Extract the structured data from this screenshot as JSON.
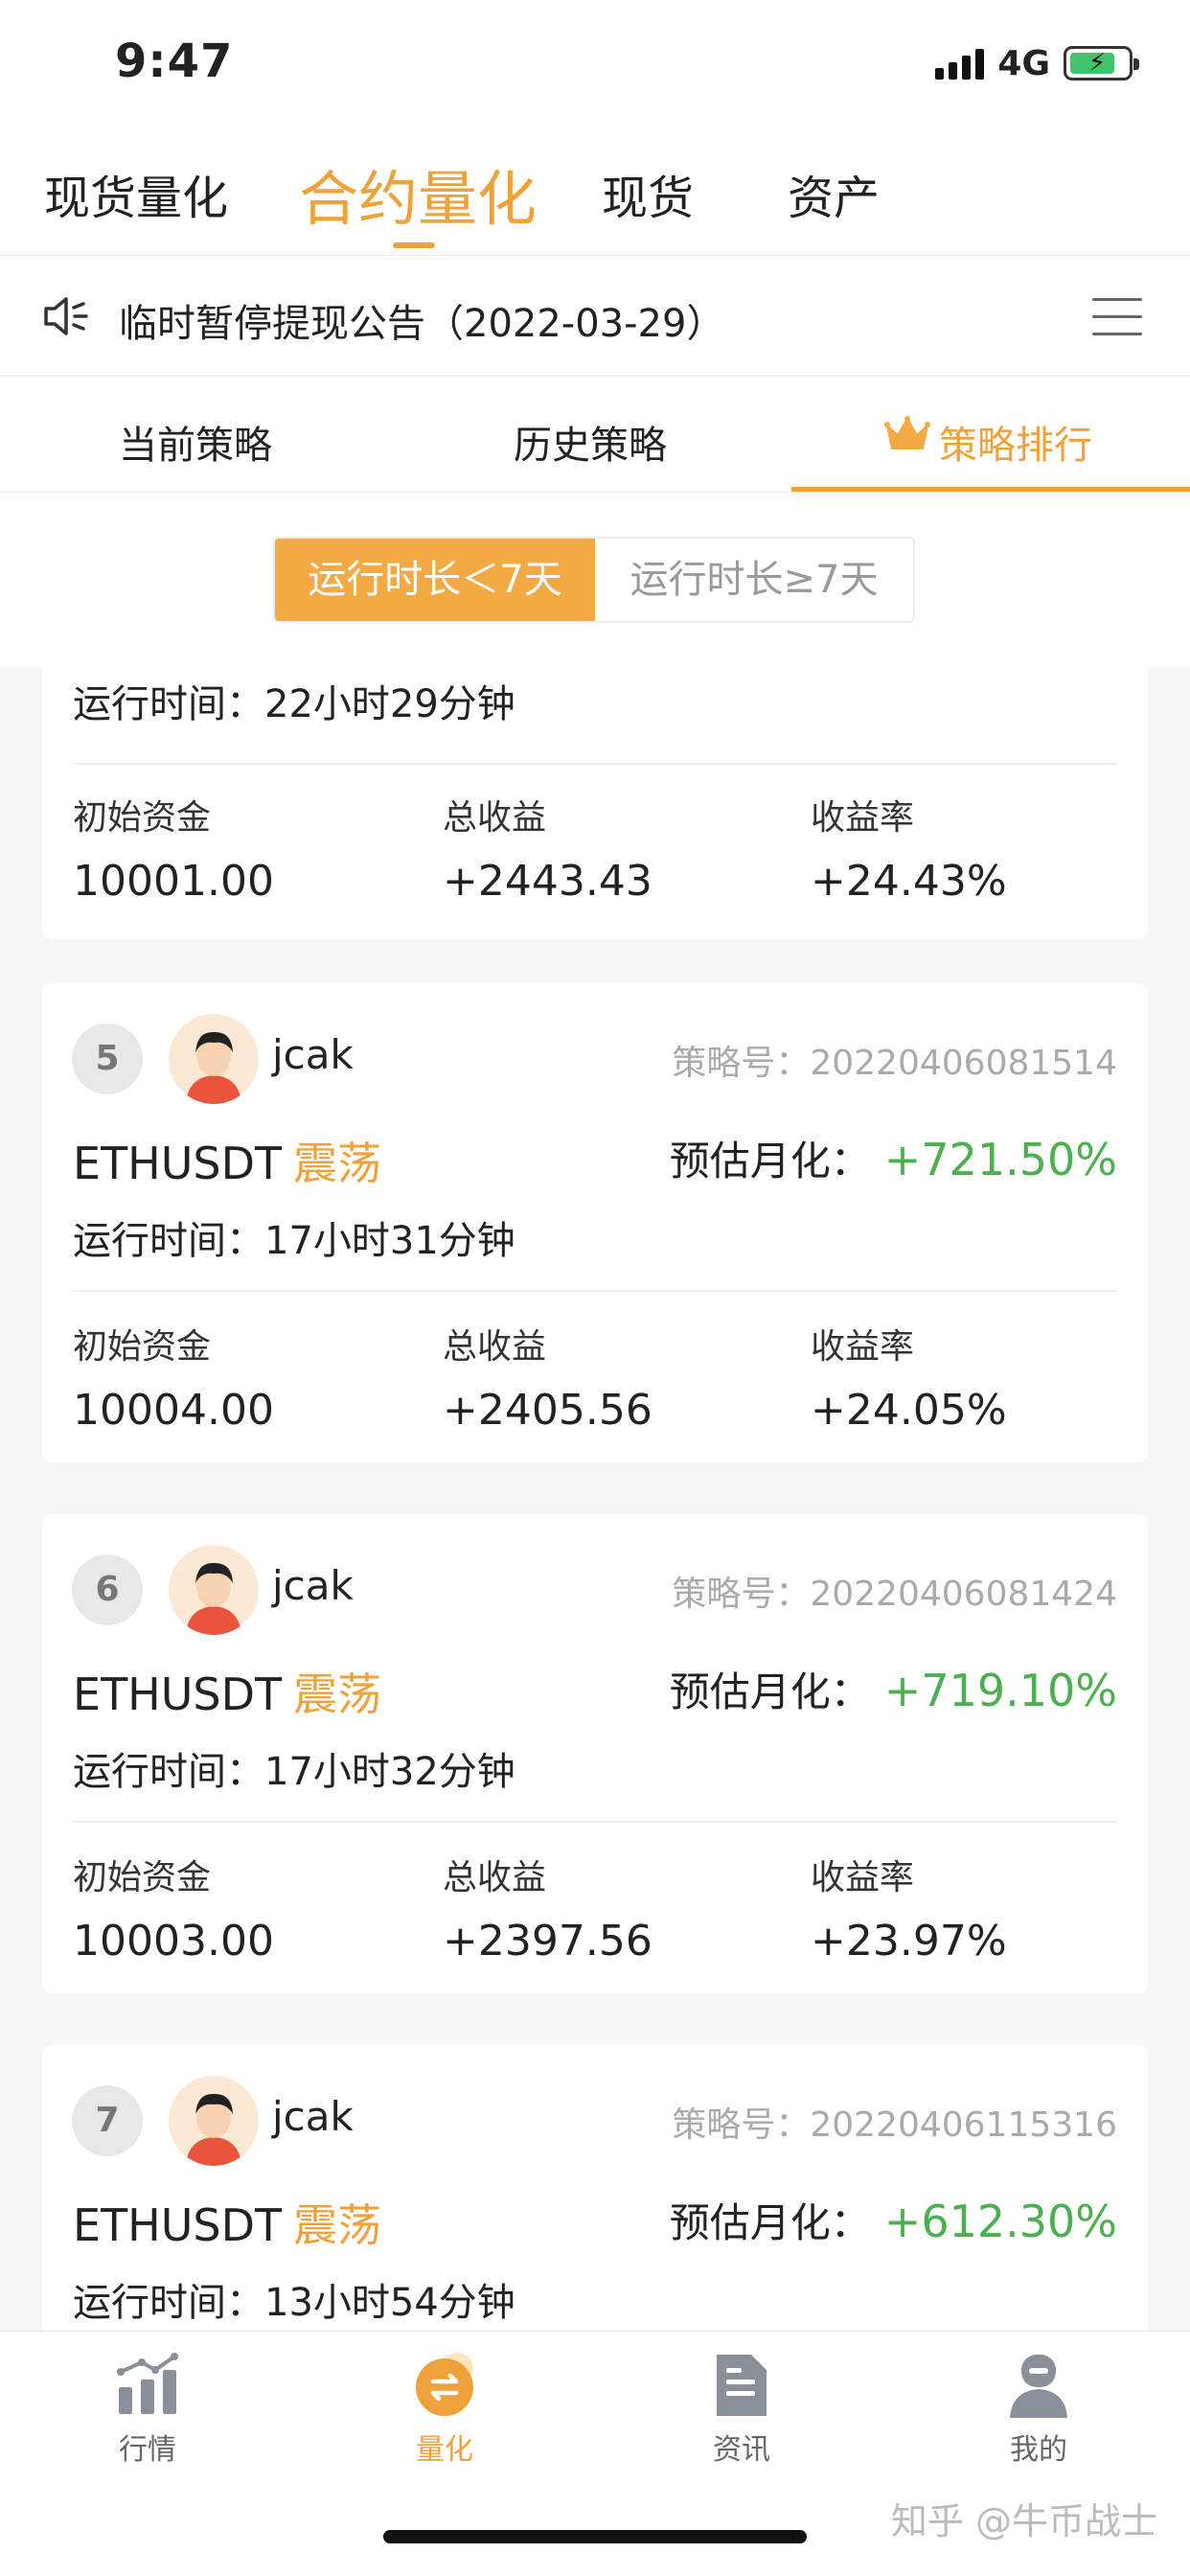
{
  "status_bar": {
    "time": "9:47",
    "network": "4G",
    "battery_level": 0.75
  },
  "top_tabs": [
    {
      "label": "现货量化",
      "active": false
    },
    {
      "label": "合约量化",
      "active": true
    },
    {
      "label": "现货",
      "active": false
    },
    {
      "label": "资产",
      "active": false
    }
  ],
  "notice": {
    "icon": "speaker-icon",
    "text": "临时暂停提现公告（2022-03-29）",
    "menu_icon": "list-menu-icon"
  },
  "sub_tabs": [
    {
      "label": "当前策略",
      "active": false
    },
    {
      "label": "历史策略",
      "active": false
    },
    {
      "label": "策略排行",
      "active": true,
      "icon": "crown-icon"
    }
  ],
  "filter": {
    "on_label": "运行时长＜7天",
    "off_label": "运行时长≥7天"
  },
  "labels": {
    "strategy_no": "策略号：",
    "monthly": "预估月化：",
    "runtime": "运行时间：",
    "initial": "初始资金",
    "total_profit": "总收益",
    "yield_rate": "收益率"
  },
  "cards": [
    {
      "runtime": "22小时29分钟",
      "initial": "10001.00",
      "total_profit": "+2443.43",
      "yield_rate": "+24.43%"
    },
    {
      "rank": "5",
      "user": "jcak",
      "strategy_no": "20220406081514",
      "pair": "ETHUSDT",
      "mode": "震荡",
      "monthly": "+721.50%",
      "runtime": "17小时31分钟",
      "initial": "10004.00",
      "total_profit": "+2405.56",
      "yield_rate": "+24.05%"
    },
    {
      "rank": "6",
      "user": "jcak",
      "strategy_no": "20220406081424",
      "pair": "ETHUSDT",
      "mode": "震荡",
      "monthly": "+719.10%",
      "runtime": "17小时32分钟",
      "initial": "10003.00",
      "total_profit": "+2397.56",
      "yield_rate": "+23.97%"
    },
    {
      "rank": "7",
      "user": "jcak",
      "strategy_no": "20220406115316",
      "pair": "ETHUSDT",
      "mode": "震荡",
      "monthly": "+612.30%",
      "runtime": "13小时54分钟"
    }
  ],
  "bottom_nav": [
    {
      "label": "行情",
      "icon": "market-chart-icon",
      "active": false
    },
    {
      "label": "量化",
      "icon": "quant-exchange-icon",
      "active": true
    },
    {
      "label": "资讯",
      "icon": "news-document-icon",
      "active": false
    },
    {
      "label": "我的",
      "icon": "profile-icon",
      "active": false
    }
  ],
  "watermark": "知乎 @牛币战士",
  "colors": {
    "accent": "#f0a23a",
    "positive": "#4caf50",
    "muted": "#aaaaaa"
  }
}
